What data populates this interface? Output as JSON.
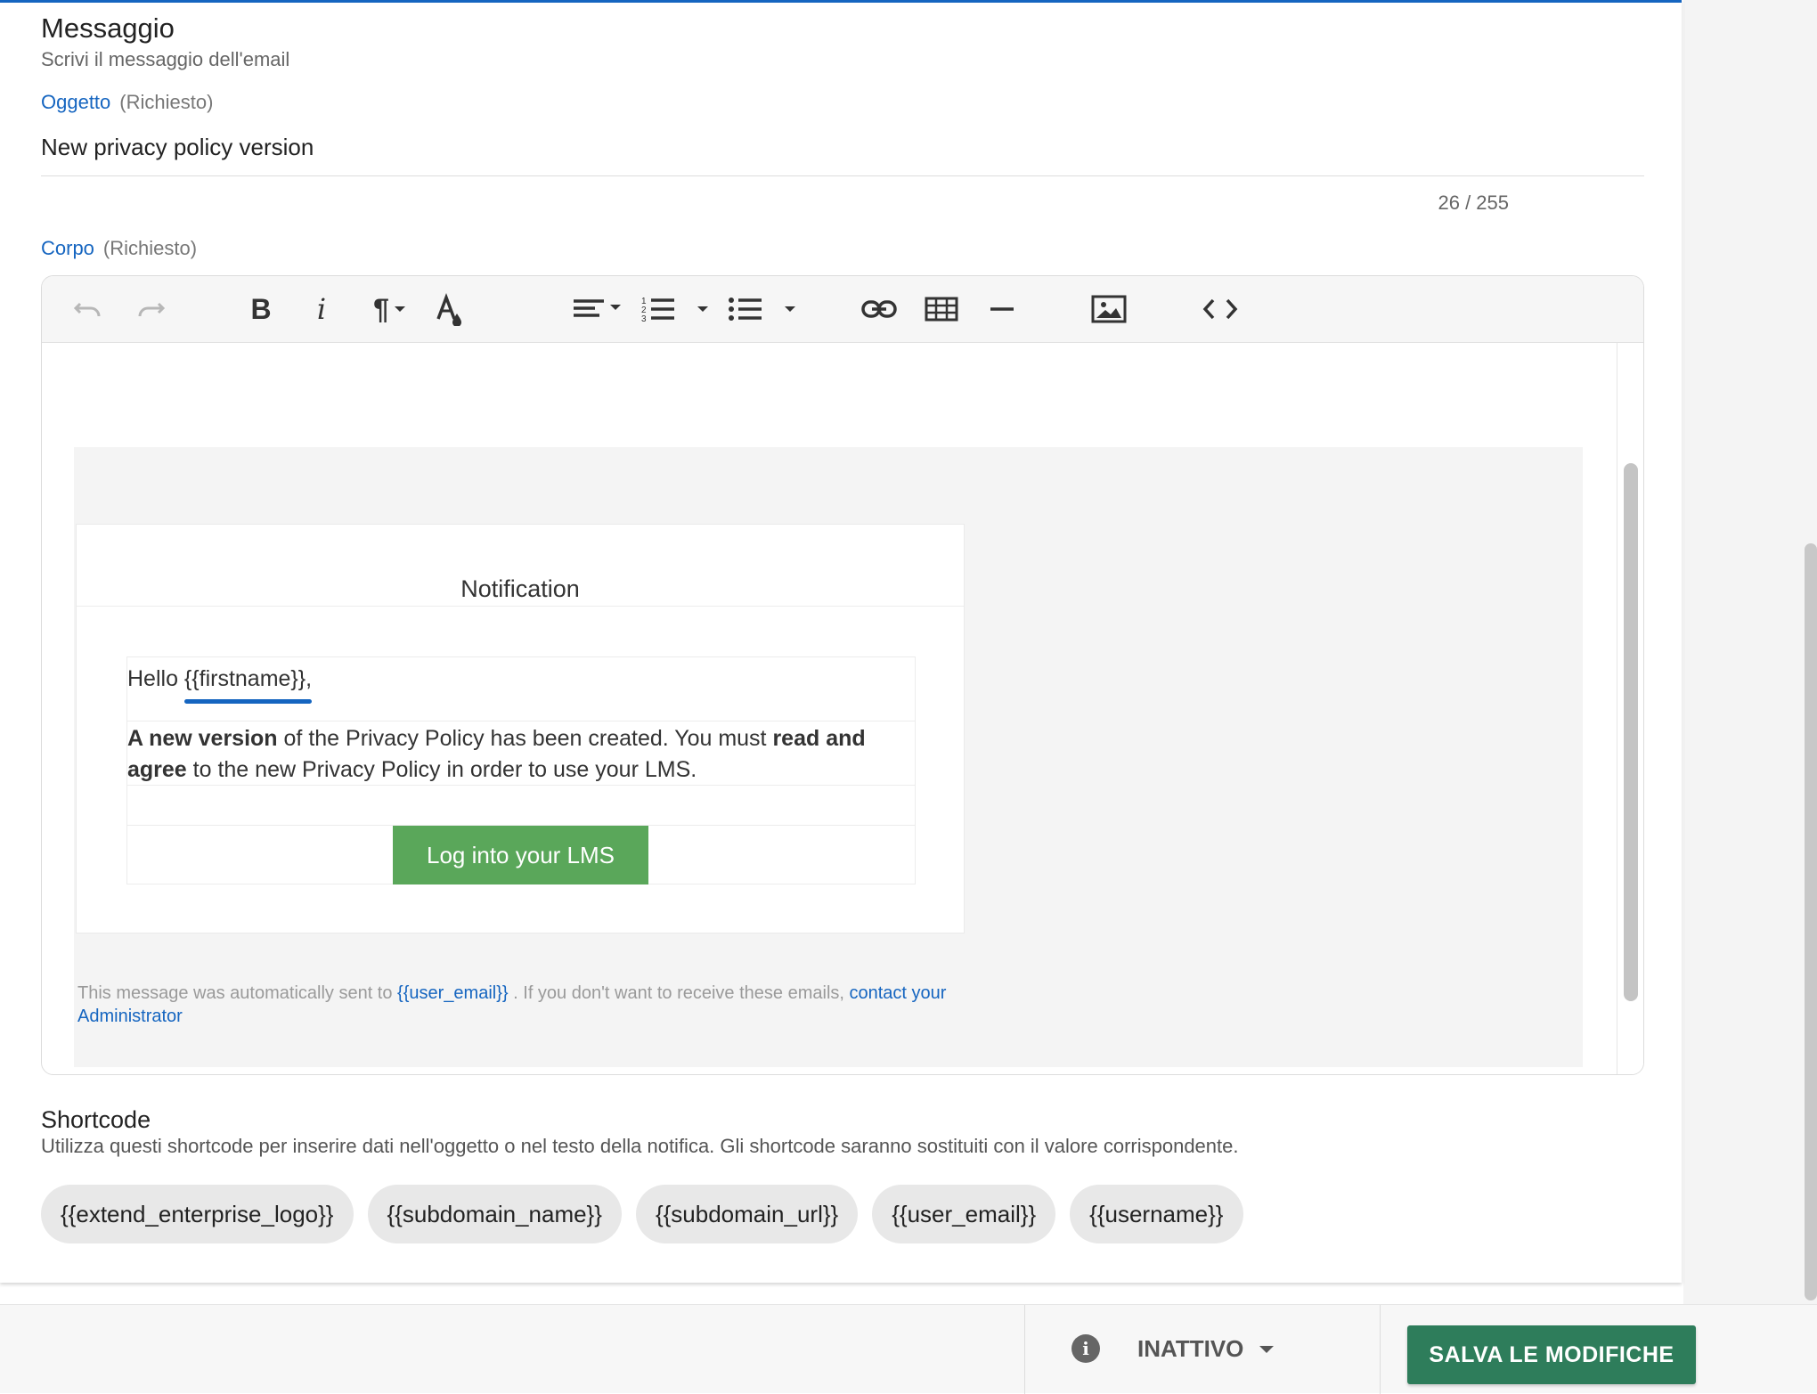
{
  "message_section": {
    "title": "Messaggio",
    "subtitle": "Scrivi il messaggio dell'email"
  },
  "subject": {
    "label": "Oggetto",
    "required": "(Richiesto)",
    "value": "New privacy policy version",
    "counter": "26 / 255"
  },
  "body": {
    "label": "Corpo",
    "required": "(Richiesto)"
  },
  "toolbar": {
    "icons": [
      "undo-icon",
      "redo-icon",
      "bold-icon",
      "italic-icon",
      "paragraph-icon",
      "font-color-icon",
      "align-icon",
      "ordered-list-icon",
      "unordered-list-icon",
      "link-icon",
      "table-icon",
      "horizontal-rule-icon",
      "image-icon",
      "code-view-icon"
    ],
    "bold_glyph": "B",
    "italic_glyph": "i",
    "paragraph_glyph": "¶"
  },
  "email": {
    "header": "Notification",
    "greeting_prefix": "Hello ",
    "greeting_placeholder": "{{firstname}},",
    "para_bold1": "A new version",
    "para_text1": " of the Privacy Policy has been created. You must ",
    "para_bold2": "read and agree",
    "para_text2": " to the new Privacy Policy in order to use your LMS.",
    "button_label": "Log into your LMS",
    "footer_prefix": "This message was automatically sent to ",
    "footer_placeholder": "{{user_email}}",
    "footer_middle": " . If you don't want to receive these emails, ",
    "footer_link": "contact your Administrator"
  },
  "shortcode": {
    "title": "Shortcode",
    "description": "Utilizza questi shortcode per inserire dati nell'oggetto o nel testo della notifica. Gli shortcode saranno sostituiti con il valore corrispondente.",
    "chips": [
      "{{extend_enterprise_logo}}",
      "{{subdomain_name}}",
      "{{subdomain_url}}",
      "{{user_email}}",
      "{{username}}"
    ]
  },
  "footer_bar": {
    "info_glyph": "i",
    "status": "INATTIVO",
    "save_label": "SALVA LE MODIFICHE"
  },
  "colors": {
    "accent": "#1565c0",
    "email_button": "#5aa75a",
    "save_button": "#2e7d5b"
  }
}
